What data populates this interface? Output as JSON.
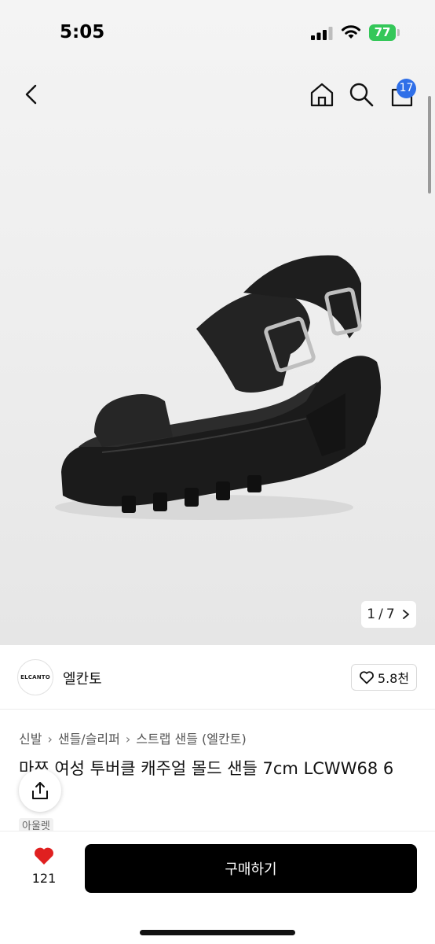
{
  "status_bar": {
    "time": "5:05",
    "battery": "77"
  },
  "header": {
    "cart_count": "17"
  },
  "gallery": {
    "current": "1",
    "total": "7",
    "separator": "/"
  },
  "seller": {
    "logo_text": "ELCANTO",
    "name": "엘칸토",
    "likes": "5.8천"
  },
  "breadcrumb": [
    "신발",
    "샌들/슬리퍼",
    "스트랩 샌들 (엘칸토)"
  ],
  "product": {
    "title": "마쯔 여성 투버클 캐주얼 몰드 샌들 7cm LCWW68  6",
    "tag": "아울렛"
  },
  "bottom_bar": {
    "wish_count": "121",
    "buy_label": "구매하기"
  },
  "colors": {
    "accent_badge": "#2f6fe8",
    "battery_green": "#34c759",
    "heart_red": "#e02020",
    "buy_button": "#000000"
  },
  "icons": [
    "back-icon",
    "home-icon",
    "search-icon",
    "cart-icon",
    "heart-outline-icon",
    "share-icon",
    "heart-filled-icon",
    "chevron-right-icon"
  ]
}
